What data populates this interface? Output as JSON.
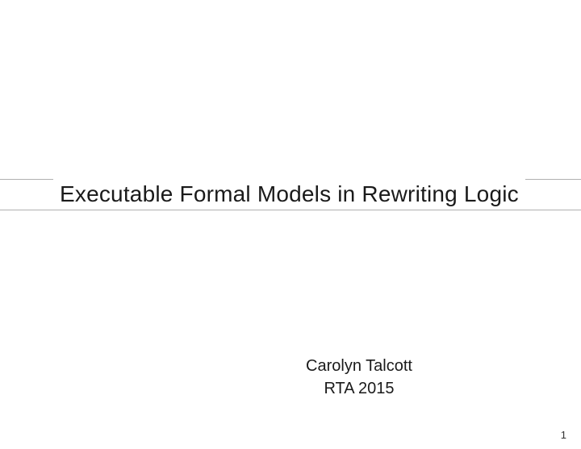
{
  "slide": {
    "title": "Executable Formal Models in Rewriting Logic",
    "author": "Carolyn Talcott",
    "venue": "RTA 2015",
    "page_number": "1"
  }
}
